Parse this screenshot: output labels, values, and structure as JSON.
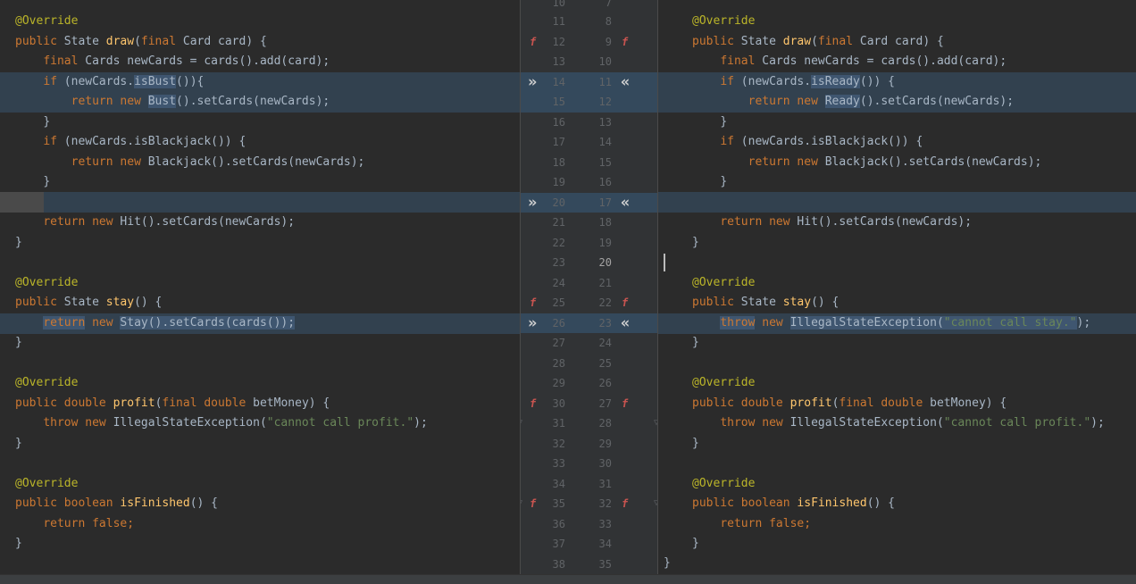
{
  "left": {
    "annotation": "@Override",
    "draw_kw": "public",
    "draw_sig": {
      "type": "State",
      "name": "draw",
      "final": "final",
      "param": "Card card) {"
    },
    "cards_line": {
      "final": "final",
      "rest": "Cards newCards = cards().add(card);"
    },
    "if_bust": {
      "if": "if",
      "pre": "(newCards.",
      "hl": "isBust",
      "post": "()){"
    },
    "return_bust": {
      "ret": "return",
      "new": "new",
      "hl": "Bust",
      "post": "().setCards(newCards);"
    },
    "close_brace": "}",
    "if_bj": {
      "if": "if",
      "rest": "(newCards.isBlackjack()) {"
    },
    "return_bj": {
      "ret": "return",
      "new": "new",
      "rest": "Blackjack().setCards(newCards);"
    },
    "return_hit": {
      "ret": "return",
      "new": "new",
      "rest": "Hit().setCards(newCards);"
    },
    "stay_sig": {
      "pub": "public",
      "type": "State",
      "name": "stay",
      "rest": "() {"
    },
    "return_stay": {
      "ret": "return",
      "new": "new",
      "hl": "Stay().setCards(cards());"
    },
    "profit_sig": {
      "pub": "public",
      "type": "double",
      "name": "profit",
      "final": "final",
      "dbl": "double",
      "rest": "betMoney) {"
    },
    "throw_profit": {
      "throw": "throw",
      "new": "new",
      "cls": "IllegalStateException(",
      "str": "\"cannot call profit.\"",
      "end": ");"
    },
    "finished_sig": {
      "pub": "public",
      "type": "boolean",
      "name": "isFinished",
      "rest": "() {"
    },
    "return_false": {
      "ret": "return",
      "val": "false",
      "end": ";"
    }
  },
  "right": {
    "annotation": "@Override",
    "draw_kw": "public",
    "draw_sig": {
      "type": "State",
      "name": "draw",
      "final": "final",
      "param": "Card card) {"
    },
    "cards_line": {
      "final": "final",
      "rest": "Cards newCards = cards().add(card);"
    },
    "if_ready": {
      "if": "if",
      "pre": "(newCards.",
      "hl": "isReady",
      "post": "()) {"
    },
    "return_ready": {
      "ret": "return",
      "new": "new",
      "hl": "Ready",
      "post": "().setCards(newCards);"
    },
    "close_brace": "}",
    "if_bj": {
      "if": "if",
      "rest": "(newCards.isBlackjack()) {"
    },
    "return_bj": {
      "ret": "return",
      "new": "new",
      "rest": "Blackjack().setCards(newCards);"
    },
    "return_hit": {
      "ret": "return",
      "new": "new",
      "rest": "Hit().setCards(newCards);"
    },
    "stay_sig": {
      "pub": "public",
      "type": "State",
      "name": "stay",
      "rest": "() {"
    },
    "throw_stay": {
      "throw": "throw",
      "new": "new",
      "cls": "IllegalStateException(",
      "str": "\"cannot call stay.\"",
      "end": ");"
    },
    "profit_sig": {
      "pub": "public",
      "type": "double",
      "name": "profit",
      "final": "final",
      "dbl": "double",
      "rest": "betMoney) {"
    },
    "throw_profit": {
      "throw": "throw",
      "new": "new",
      "cls": "IllegalStateException(",
      "str": "\"cannot call profit.\"",
      "end": ");"
    },
    "finished_sig": {
      "pub": "public",
      "type": "boolean",
      "name": "isFinished",
      "rest": "() {"
    },
    "return_false": {
      "ret": "return",
      "val": "false",
      "end": ";"
    }
  },
  "gutter": {
    "left_lines": [
      "11",
      "12",
      "13",
      "14",
      "15",
      "16",
      "17",
      "18",
      "19",
      "20",
      "21",
      "22",
      "23",
      "24",
      "25",
      "26",
      "27",
      "28",
      "29",
      "30",
      "31",
      "32",
      "33",
      "34",
      "35",
      "36",
      "37",
      "38"
    ],
    "right_lines": [
      "8",
      "9",
      "10",
      "11",
      "12",
      "13",
      "14",
      "15",
      "16",
      "17",
      "18",
      "19",
      "20",
      "21",
      "22",
      "23",
      "24",
      "25",
      "26",
      "27",
      "28",
      "29",
      "30",
      "31",
      "32",
      "33",
      "34",
      "35"
    ],
    "top_left_partial": "10",
    "top_right_partial": "7",
    "accept_arrow": "»",
    "revert_arrow": "«",
    "fx_icon": "f"
  }
}
